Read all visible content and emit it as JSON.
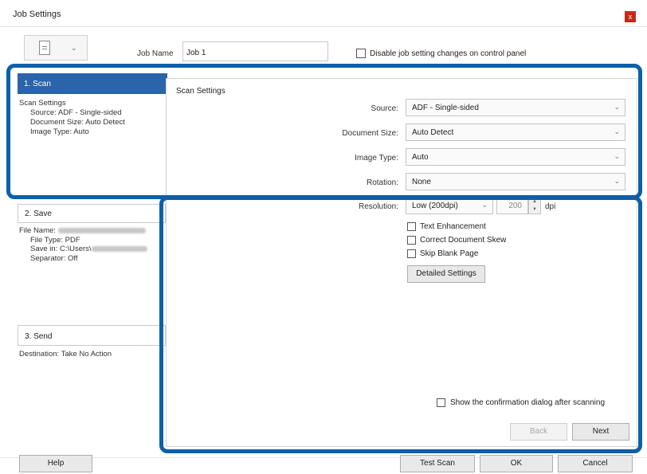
{
  "window": {
    "title": "Job Settings",
    "close_label": "x"
  },
  "header": {
    "dropdown_chevron": "⌄",
    "job_name_label": "Job Name",
    "job_name_value": "Job 1",
    "disable_label": "Disable job setting changes on control panel"
  },
  "steps": {
    "scan": {
      "label": "1. Scan",
      "info_title": "Scan Settings",
      "info_lines": [
        "Source: ADF - Single-sided",
        "Document Size: Auto Detect",
        "Image Type: Auto"
      ]
    },
    "save": {
      "label": "2. Save",
      "file_name": "File Name:",
      "file_type": "File Type: PDF",
      "save_in": "Save in: C:\\Users\\",
      "separator": "Separator: Off"
    },
    "send": {
      "label": "3. Send",
      "destination": "Destination: Take No Action"
    }
  },
  "scan_settings": {
    "title": "Scan Settings",
    "source": {
      "label": "Source:",
      "value": "ADF - Single-sided"
    },
    "document_size": {
      "label": "Document Size:",
      "value": "Auto Detect"
    },
    "image_type": {
      "label": "Image Type:",
      "value": "Auto"
    },
    "rotation": {
      "label": "Rotation:",
      "value": "None"
    },
    "resolution": {
      "label": "Resolution:",
      "value": "Low (200dpi)",
      "dpi_value": "200",
      "unit": "dpi"
    },
    "chevron": "⌄",
    "spin_up": "▲",
    "spin_down": "▼",
    "checkboxes": {
      "text_enhancement": "Text Enhancement",
      "correct_skew": "Correct Document Skew",
      "skip_blank": "Skip Blank Page"
    },
    "detailed_settings": "Detailed Settings",
    "confirmation": "Show the confirmation dialog after scanning",
    "back": "Back",
    "next": "Next"
  },
  "footer": {
    "help": "Help",
    "test_scan": "Test Scan",
    "ok": "OK",
    "cancel": "Cancel"
  },
  "colors": {
    "accent": "#2b64a8",
    "highlight": "#0d60a8",
    "close": "#c42b1c"
  }
}
